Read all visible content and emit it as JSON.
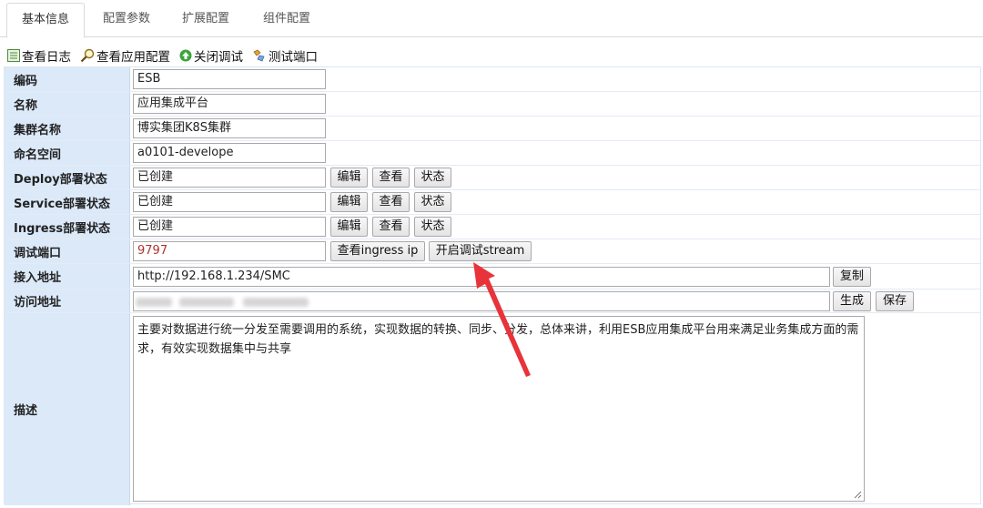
{
  "tabs": [
    {
      "label": "基本信息",
      "active": true
    },
    {
      "label": "配置参数",
      "active": false
    },
    {
      "label": "扩展配置",
      "active": false
    },
    {
      "label": "组件配置",
      "active": false
    }
  ],
  "toolbar": {
    "view_log": "查看日志",
    "view_app_config": "查看应用配置",
    "close_debug": "关闭调试",
    "test_port": "测试端口"
  },
  "form": {
    "code": {
      "label": "编码",
      "value": "ESB"
    },
    "name": {
      "label": "名称",
      "value": "应用集成平台"
    },
    "cluster": {
      "label": "集群名称",
      "value": "博实集团K8S集群"
    },
    "namespace": {
      "label": "命名空间",
      "value": "a0101-develope"
    },
    "deploy": {
      "label": "Deploy部署状态",
      "value": "已创建"
    },
    "service": {
      "label": "Service部署状态",
      "value": "已创建"
    },
    "ingress": {
      "label": "Ingress部署状态",
      "value": "已创建"
    },
    "debug_port": {
      "label": "调试端口",
      "value": "9797"
    },
    "access_addr": {
      "label": "接入地址",
      "value": "http://192.168.1.234/SMC"
    },
    "visit_addr": {
      "label": "访问地址",
      "value": ""
    },
    "desc": {
      "label": "描述",
      "value": "主要对数据进行统一分发至需要调用的系统，实现数据的转换、同步、分发，总体来讲，利用ESB应用集成平台用来满足业务集成方面的需求，有效实现数据集中与共享"
    }
  },
  "buttons": {
    "edit": "编辑",
    "view": "查看",
    "status": "状态",
    "view_ingress_ip": "查看ingress ip",
    "start_debug_stream": "开启调试stream",
    "copy": "复制",
    "generate": "生成",
    "save": "保存"
  },
  "colors": {
    "label_bg": "#dce9f9",
    "port_text": "#b0332e",
    "annotation_arrow": "#e8333a"
  }
}
